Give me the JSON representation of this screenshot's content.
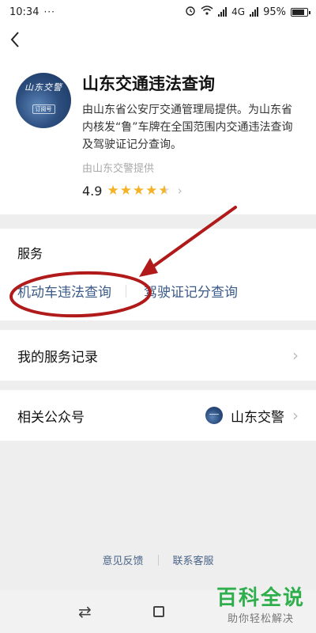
{
  "statusbar": {
    "time": "10:34",
    "dots": "···",
    "network": "4G",
    "battery": "95%"
  },
  "profile": {
    "avatar_text": "山东交警",
    "avatar_tag": "订阅号",
    "name": "山东交通违法查询",
    "description": "由山东省公安厅交通管理局提供。为山东省内核发“鲁”车牌在全国范围内交通违法查询及驾驶证记分查询。",
    "provider": "由山东交警提供",
    "rating": "4.9",
    "stars": "★★★★"
  },
  "services": {
    "title": "服务",
    "items": [
      "机动车违法查询",
      "驾驶证记分查询"
    ]
  },
  "records": {
    "label": "我的服务记录"
  },
  "related": {
    "label": "相关公众号",
    "account": "山东交警"
  },
  "footer": {
    "feedback": "意见反馈",
    "contact": "联系客服"
  },
  "watermark": {
    "main": "百科全说",
    "sub": "助你轻松解决"
  },
  "colors": {
    "link": "#3a5a88",
    "star": "#f5b225",
    "annotation": "#b01a1a",
    "watermark": "#2fae4c"
  }
}
